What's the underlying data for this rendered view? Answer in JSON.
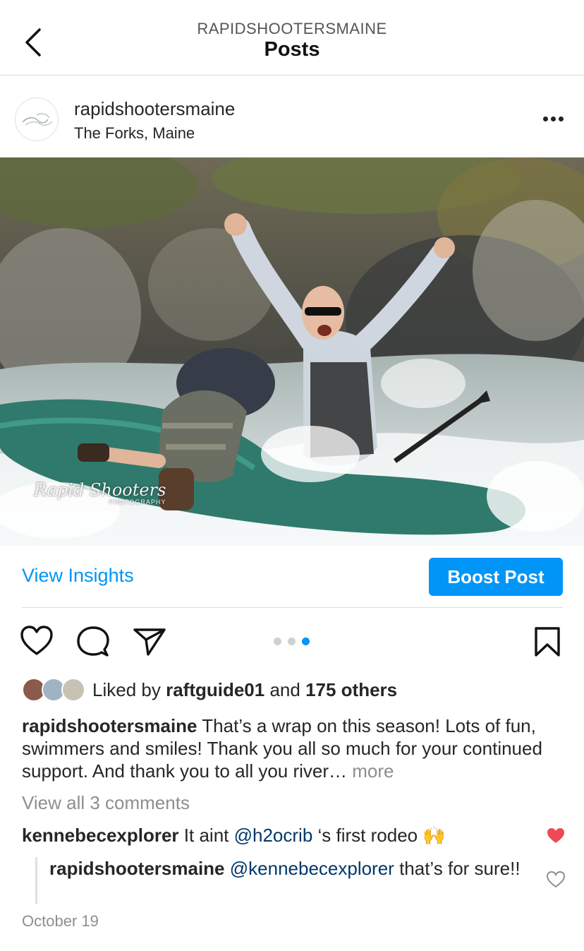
{
  "header": {
    "account": "RAPIDSHOOTERSMAINE",
    "title": "Posts"
  },
  "post": {
    "username": "rapidshootersmaine",
    "location": "The Forks, Maine",
    "watermark": "Rapid Shooters",
    "watermark_sub": "PHOTOGRAPHY"
  },
  "actions": {
    "insights_label": "View Insights",
    "boost_label": "Boost Post"
  },
  "carousel": {
    "count": 3,
    "active": 3
  },
  "likes": {
    "prefix": "Liked by ",
    "first_liker": "raftguide01",
    "middle": " and ",
    "others": "175 others"
  },
  "caption": {
    "username": "rapidshootersmaine",
    "text": " That’s a wrap on this season!  Lots of fun, swimmers and smiles! Thank you all so much for your continued support.  And thank you to all you river… ",
    "more": "more"
  },
  "comments": {
    "view_all": "View all 3 comments",
    "first": {
      "username": "kennebecexplorer",
      "text_before": " It aint ",
      "mention": "@h2ocrib",
      "text_after": " ‘s first rodeo ",
      "emoji": "🙌",
      "liked": true
    },
    "reply": {
      "username": "rapidshootersmaine",
      "mention": "@kennebecexplorer",
      "text_after": " that’s for sure!!",
      "liked": false
    }
  },
  "date": "October 19",
  "colors": {
    "accent": "#0095f6",
    "liked_heart": "#ed4956",
    "muted_text": "#8e8e8e"
  }
}
